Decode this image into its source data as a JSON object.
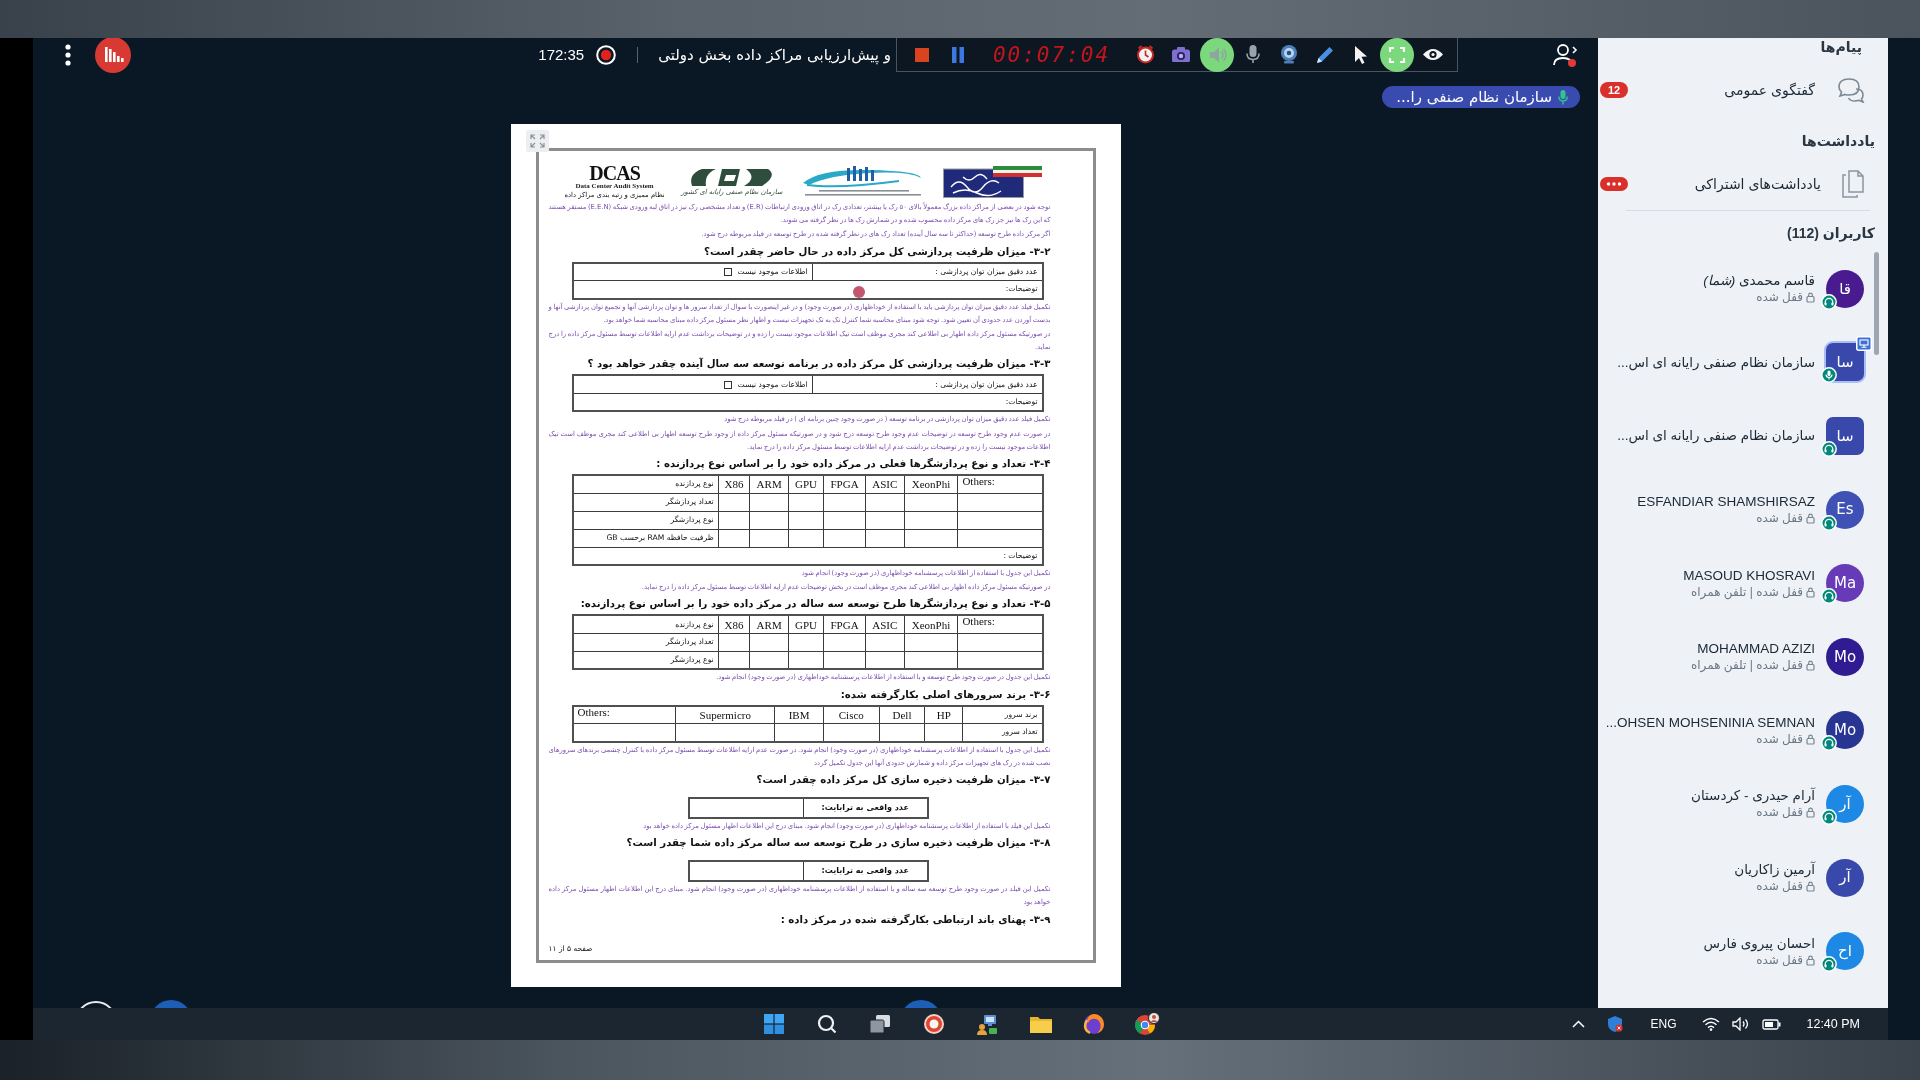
{
  "top_bar": {
    "elapsed": "172:35",
    "title": "و پیش‌ارزیابی مراکز داده بخش دولتی",
    "controls": [
      {
        "kind": "stop"
      },
      {
        "kind": "pause"
      }
    ],
    "timer": "00:07:04",
    "tools": [
      {
        "kind": "clock",
        "active": false
      },
      {
        "kind": "camera",
        "active": false
      },
      {
        "kind": "speaker",
        "active": true
      },
      {
        "kind": "mic",
        "active": false
      },
      {
        "kind": "webcam",
        "active": false
      },
      {
        "kind": "pen",
        "active": false
      },
      {
        "kind": "cursor",
        "active": false
      },
      {
        "kind": "fullscreen",
        "active": true
      },
      {
        "kind": "eye",
        "active": false
      }
    ]
  },
  "presenter": {
    "name": "سازمان نظام صنفی را..."
  },
  "document": {
    "logos": [
      {
        "kind": "flag"
      },
      {
        "kind": "swoosh"
      },
      {
        "kind": "emblem",
        "caption": "سازمان نظام صنفی رایانه ای کشور"
      },
      {
        "kind": "wordmark",
        "title": "DCAS",
        "subtitle": "Data Center Audit System",
        "caption": "نظام ممیزی و رتبه بندی مراکز داده"
      }
    ],
    "blocks": [
      {
        "kind": "note",
        "paragraphs": [
          "توجه شود در بعضی از مراکز داده بزرگ معمولاً بالای ۵۰ رک یا بیشتر، تعدادی رک در اتاق ورودی ارتباطات (E.R) و تعداد مشخصی رک نیز در اتاق لبه ورودی شبکه (E.E.N) مستقر هستند که این رک ها نیز جز رک های مرکز داده محسوب شده و در شمارش رک ها در نظر گرفته می شوند.",
          "اگر مرکز داده طرح توسعه (حداکثر تا سه سال آینده) تعداد رک های در نظر گرفته شده در طرح توسعه در فیلد مربوطه درج شود."
        ]
      },
      {
        "kind": "heading",
        "text": "۳-۲- میزان ظرفیت پردازشی کل مرکز داده در حال حاضر چقدر است؟"
      },
      {
        "kind": "field_table",
        "label": "عدد دقیق میزان توان پردازشی :",
        "option": "اطلاعات موجود نیست",
        "checked": false,
        "notes_label": "توضیحات:"
      },
      {
        "kind": "note",
        "paragraphs": [
          "تکمیل فیلد عدد دقیق میزان توان پردازشی باید با استفاده از خوداظهاری (در صورت وجود) و در غیر اینصورت با سوال از تعداد سرور ها و توان پردازشی آنها و تجمیع توان پردازشی آنها و بدست آوردن عدد حدودی آن تعیین شود. توجه شود مبنای محاسبه شما کنترل تک به تک تجهیزات نیست و اظهار نظر مسئول مرکز داده مبنای محاسبه شما خواهد بود.",
          "در صورتیکه مسئول مرکز داده اظهار بی اطلاعی کند مجری موظف است تیک اطلاعات موجود نیست را زده و در توضیحات برداشت عدم ارایه اطلاعات توسط مسئول مرکز داده را درج نماید."
        ]
      },
      {
        "kind": "heading",
        "text": "۳-۳- میزان ظرفیت پردازشی کل مرکز داده در برنامه توسعه سه سال آینده چقدر خواهد بود ؟"
      },
      {
        "kind": "field_table",
        "label": "عدد دقیق میزان توان پردازشی :",
        "option": "اطلاعات موجود نیست",
        "checked": false,
        "notes_label": "توضیحات:"
      },
      {
        "kind": "note",
        "paragraphs": [
          "تکمیل فیلد عدد دقیق میزان توان پردازشی در برنامه توسعه ( در صورت وجود چنین برنامه ای ) در فیلد مربوطه درج شود",
          "در صورت عدم وجود طرح توسعه در توضیحات عدم وجود طرح توسعه درج شود و در صورتیکه مسئول مرکز داده از وجود طرح توسعه اظهار بی اطلاعی کند مجری موظف است تیک اطلاعات موجود نیست را زده و در توضیحات برداشت عدم ارایه اطلاعات توسط مسئول مرکز داده را درج نماید."
        ]
      },
      {
        "kind": "heading",
        "text": "۳-۴- تعداد و نوع پردازشگرها فعلی در مرکز داده خود را بر اساس نوع پردازنده :"
      },
      {
        "kind": "left_grid",
        "columns": [
          "Others:",
          "XeonPhi",
          "ASIC",
          "FPGA",
          "GPU",
          "ARM",
          "X86",
          "نوع پردازنده"
        ],
        "rows": [
          "تعداد پردازشگر",
          "نوع پردازشگر",
          "ظرفیت حافظه RAM برحسب GB"
        ],
        "notes_label": "توضیحات :"
      },
      {
        "kind": "note",
        "paragraphs": [
          "تکمیل این جدول با استفاده از اطلاعات پرسشنامه خوداظهاری (در صورت وجود) انجام شود",
          "در صورتیکه مسئول مرکز داده اظهار بی اطلاعی کند مجری موظف است در بخش توضیحات عدم ارایه اطلاعات توسط مسئول مرکز داده را درج نماید."
        ]
      },
      {
        "kind": "heading",
        "text": "۳-۵- تعداد و نوع پردازشگرها طرح توسعه سه ساله در مرکز داده خود را بر اساس نوع پردازنده:"
      },
      {
        "kind": "left_grid",
        "columns": [
          "Others:",
          "XeonPhi",
          "ASIC",
          "FPGA",
          "GPU",
          "ARM",
          "X86",
          "نوع پردازنده"
        ],
        "rows": [
          "تعداد پردازشگر",
          "نوع پردازشگر"
        ]
      },
      {
        "kind": "note",
        "paragraphs": [
          "تکمیل این جدول در صورت وجود طرح توسعه و با استفاده از اطلاعات پرسشنامه خوداظهاری (در صورت وجود) انجام شود."
        ]
      },
      {
        "kind": "heading",
        "text": "۳-۶- برند سرورهای اصلی بکارگرفته شده:"
      },
      {
        "kind": "right_grid",
        "columns": [
          "برند سرور",
          "HP",
          "Dell",
          "Cisco",
          "IBM",
          "Supermicro",
          "Others:"
        ],
        "rows": [
          "تعداد سرور"
        ]
      },
      {
        "kind": "note",
        "paragraphs": [
          "تکمیل این جدول با استفاده از اطلاعات پرسشنامه خوداظهاری (در صورت وجود) انجام شود. در صورت عدم ارایه اطلاعات توسط مسئول مرکز داده با کنترل چشمی برندهای سرورهای نصب شده در رک های تجهیزات مرکز داده و شمارش حدودی آنها این جدول تکمیل گردد"
        ]
      },
      {
        "kind": "heading",
        "text": "۳-۷- میزان ظرفیت ذخیره سازی کل مرکز داده چقدر است؟"
      },
      {
        "kind": "value_box",
        "label": "عدد واقعی به ترابایت:"
      },
      {
        "kind": "note",
        "paragraphs": [
          "تکمیل این فیلد با استفاده از اطلاعات پرسشنامه خوداظهاری (در صورت وجود) انجام شود. مبنای درج این اطلاعات اظهار مسئول مرکز داده خواهد بود"
        ]
      },
      {
        "kind": "heading",
        "text": "۳-۸- میزان ظرفیت ذخیره سازی در طرح توسعه سه ساله مرکز داده شما چقدر است؟"
      },
      {
        "kind": "value_box",
        "label": "عدد واقعی به ترابایت:"
      },
      {
        "kind": "note",
        "paragraphs": [
          "تکمیل این فیلد در صورت وجود طرح توسعه سه ساله و با استفاده از اطلاعات پرسشنامه خوداظهاری (در صورت وجود) انجام شود. مبنای درج این اطلاعات اظهار مسئول مرکز داده خواهد بود"
        ]
      },
      {
        "kind": "heading",
        "text": "۳-۹- پهنای باند ارتباطی بکارگرفته شده در مرکز داده :"
      }
    ],
    "footer": "صفحه ۵ از ۱۱"
  },
  "sidebar": {
    "messages_title": "پیام‌ها",
    "public_chat": {
      "label": "گفتگوی عمومی",
      "unread": "12"
    },
    "notes_title": "یادداشت‌ها",
    "shared_notes": {
      "label": "یادداشت‌های اشتراکی"
    },
    "users_title": "کاربران (112)",
    "users": [
      {
        "kind": "viewer",
        "name": "قاسم محمدی *(شما)*",
        "status": "قفل شده",
        "initials": "قا",
        "color": "#4a1b8f",
        "presenter": false,
        "headset": true,
        "mic": false
      },
      {
        "kind": "moderator",
        "name": "سازمان نظام صنفی رایانه ای اس...",
        "initials": "سا",
        "color": "#3949ab",
        "presenter": true,
        "headset": false,
        "mic": true
      },
      {
        "kind": "moderator",
        "name": "سازمان نظام صنفی رایانه ای اس...",
        "initials": "سا",
        "color": "#3949ab",
        "presenter": false,
        "headset": true,
        "mic": false
      },
      {
        "kind": "viewer",
        "name": "ESFANDIAR SHAMSHIRSAZ",
        "status": "قفل شده",
        "initials": "Es",
        "color": "#3f51b5",
        "presenter": false,
        "headset": true,
        "mic": false
      },
      {
        "kind": "viewer",
        "name": "MASOUD KHOSRAVI",
        "status": "قفل شده | تلفن همراه",
        "initials": "Ma",
        "color": "#673ab7",
        "presenter": false,
        "headset": true,
        "mic": false
      },
      {
        "kind": "viewer",
        "name": "MOHAMMAD AZIZI",
        "status": "قفل شده | تلفن همراه",
        "initials": "Mo",
        "color": "#311b92",
        "presenter": false,
        "headset": false,
        "mic": false
      },
      {
        "kind": "viewer",
        "name": "...OHSEN MOHSENINIA SEMNAN",
        "status": "قفل شده",
        "initials": "Mo",
        "color": "#283593",
        "presenter": false,
        "headset": true,
        "mic": false
      },
      {
        "kind": "viewer",
        "name": "آرام حیدری - کردستان",
        "status": "قفل شده",
        "initials": "آر",
        "color": "#1e88e5",
        "presenter": false,
        "headset": true,
        "mic": false
      },
      {
        "kind": "viewer",
        "name": "آرمین زاکاریان",
        "status": "قفل شده",
        "initials": "آر",
        "color": "#3949ab",
        "presenter": false,
        "headset": false,
        "mic": false
      },
      {
        "kind": "viewer",
        "name": "احسان پیروی فارس",
        "status": "قفل شده",
        "initials": "اح",
        "color": "#1e88e5",
        "presenter": false,
        "headset": true,
        "mic": false
      }
    ]
  },
  "taskbar": {
    "language": "ENG",
    "time": "12:40 PM"
  }
}
